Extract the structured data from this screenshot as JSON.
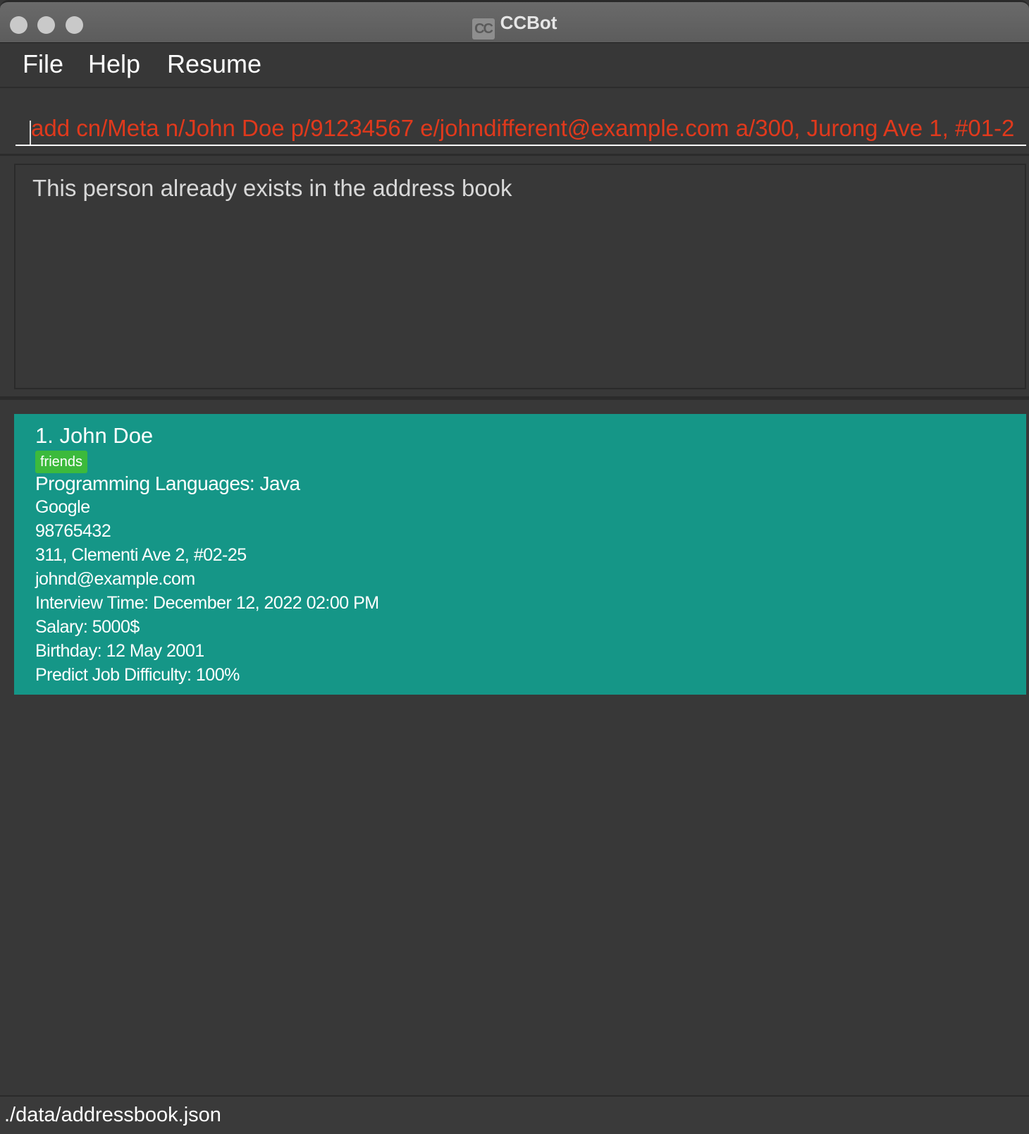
{
  "window": {
    "title": "CCBot",
    "icon_name": "app-icon",
    "icon_glyph": "CC"
  },
  "menu": {
    "file": "File",
    "help": "Help",
    "resume": "Resume"
  },
  "command": {
    "value": "add cn/Meta n/John Doe p/91234567 e/johndifferent@example.com a/300, Jurong Ave 1, #01-2"
  },
  "result": {
    "message": "This person already exists in the address book"
  },
  "persons": [
    {
      "index_name": "1.  John Doe",
      "tag": "friends",
      "languages": "Programming Languages: Java",
      "company": "Google",
      "phone": "98765432",
      "address": "311, Clementi Ave 2, #02-25",
      "email": "johnd@example.com",
      "interview": "Interview Time: December 12, 2022 02:00 PM",
      "salary": "Salary: 5000$",
      "birthday": "Birthday: 12 May 2001",
      "difficulty": "Predict Job Difficulty: 100%"
    }
  ],
  "status": {
    "file_path": "./data/addressbook.json"
  },
  "colors": {
    "background": "#383838",
    "card": "#159687",
    "tag": "#3cba3c",
    "command_text": "#e0391c"
  }
}
